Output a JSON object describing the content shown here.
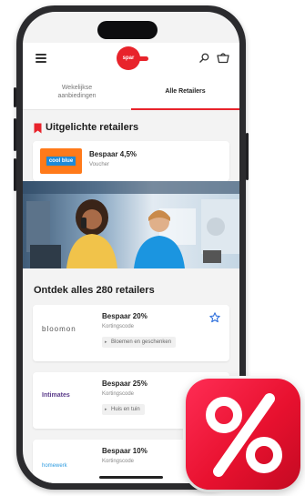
{
  "header": {
    "logo_text": "spar"
  },
  "tabs": [
    {
      "label": "Wekelijkse aanbiedingen",
      "active": false
    },
    {
      "label": "Alle Retailers",
      "active": true
    }
  ],
  "featured": {
    "title": "Uitgelichte retailers",
    "retailer_logo": "cool blue",
    "save": "Bespaar 4,5%",
    "sub": "Voucher"
  },
  "discover": {
    "title": "Ontdek alles 280 retailers",
    "retailers": [
      {
        "logo": "bloomon",
        "save": "Bespaar 20%",
        "sub": "Kortingscode",
        "chip": "Bloemen en geschenken"
      },
      {
        "logo": "Intimates",
        "save": "Bespaar 25%",
        "sub": "Kortingscode",
        "chip": "Huis en tuin"
      },
      {
        "logo": "homewerk",
        "save": "Bespaar 10%",
        "sub": "Kortingscode",
        "chip": ""
      }
    ]
  },
  "colors": {
    "brand_red": "#e8232b",
    "app_icon_gradient_top": "#ff2d55",
    "app_icon_gradient_bottom": "#c40a22",
    "coolblue_orange": "#ff7a1a",
    "coolblue_blue": "#1d8ad9"
  },
  "icons": {
    "menu": "hamburger-icon",
    "search": "search-icon",
    "cart": "cart-icon",
    "bookmark": "bookmark-icon",
    "favorite": "star-icon",
    "app": "percent-icon"
  }
}
